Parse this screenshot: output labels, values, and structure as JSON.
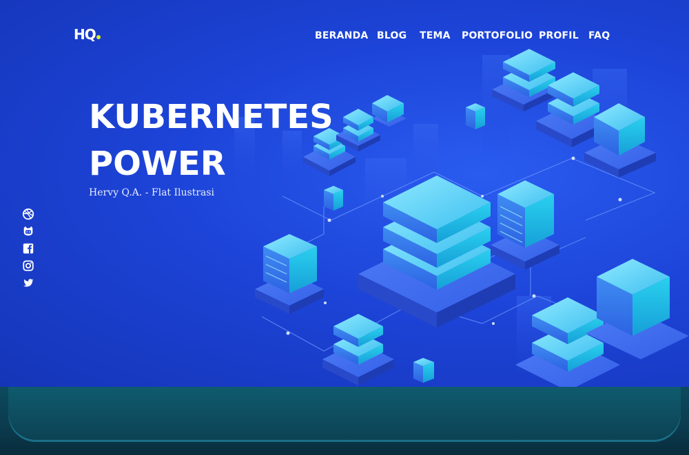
{
  "logo": {
    "text": "HQ"
  },
  "nav": {
    "items": [
      {
        "label": "BERANDA"
      },
      {
        "label": "BLOG"
      },
      {
        "label": "TEMA"
      },
      {
        "label": "PORTOFOLIO"
      },
      {
        "label": "PROFIL"
      },
      {
        "label": "FAQ"
      }
    ]
  },
  "hero": {
    "title_line1": "KUBERNETES",
    "title_line2": "POWER",
    "subtitle": "Hervy Q.A. - Flat Ilustrasi"
  },
  "social": {
    "icons": [
      "dribbble-icon",
      "github-icon",
      "facebook-icon",
      "instagram-icon",
      "twitter-icon"
    ]
  },
  "colors": {
    "background": "#1d44d8",
    "accent_dot": "#d9f22a",
    "server_cyan": "#27c6ee",
    "bottom_band": "#0d4a5e"
  }
}
